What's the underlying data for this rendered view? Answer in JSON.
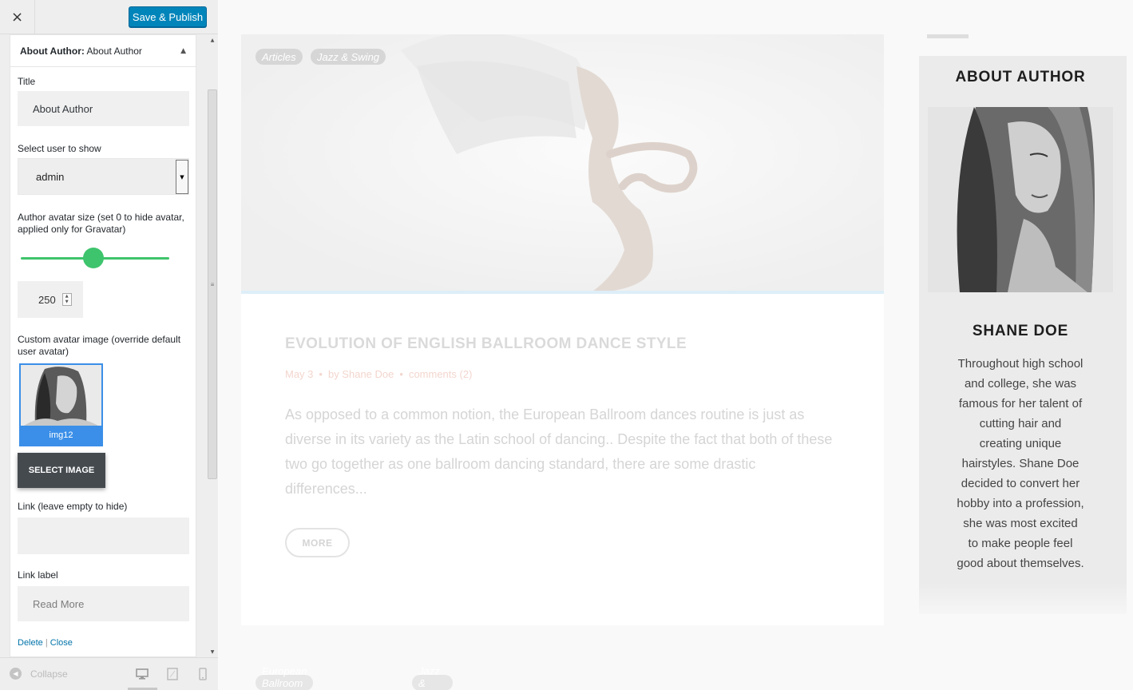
{
  "customizer": {
    "close_label": "×",
    "publish_label": "Save & Publish",
    "panel": {
      "title_prefix": "About Author:",
      "title_name": "About Author",
      "fields": {
        "title_label": "Title",
        "title_value": "About Author",
        "user_label": "Select user to show",
        "user_value": "admin",
        "avatar_size_label": "Author avatar size (set 0 to hide avatar, applied only for Gravatar)",
        "avatar_size_value": "250",
        "avatar_size_fraction": 0.49,
        "custom_avatar_label": "Custom avatar image (override default user avatar)",
        "image_caption": "img12",
        "select_image_label": "SELECT IMAGE",
        "link_label": "Link (leave empty to hide)",
        "link_value": "",
        "link_text_label": "Link label",
        "link_text_value": "Read More"
      },
      "actions": {
        "delete": "Delete",
        "separator": "|",
        "close": "Close"
      }
    },
    "footer": {
      "collapse_label": "Collapse",
      "devices": [
        "desktop-icon",
        "tablet-icon",
        "mobile-icon"
      ]
    }
  },
  "preview": {
    "post": {
      "tags": [
        "Articles",
        "Jazz & Swing"
      ],
      "title": "EVOLUTION OF ENGLISH BALLROOM DANCE STYLE",
      "date": "May 3",
      "bullet": "•",
      "author": "by Shane Doe",
      "comments": "comments (2)",
      "excerpt": "As opposed to a common notion, the European Ballroom dances routine is just as diverse in its variety as the Latin school of dancing.. Despite the fact that both of these two go together as one ballroom dancing standard, there are some drastic differences...",
      "more_label": "MORE"
    },
    "next_post_tags": [
      "European Ballroom Dances",
      "Jazz & Swing"
    ],
    "author_widget": {
      "title": "ABOUT AUTHOR",
      "name": "SHANE DOE",
      "bio": "Throughout high school and college, she was famous for her talent of cutting hair and creating unique hairstyles. Shane Doe decided to convert her hobby into a profession, she was most excited to make people feel good about themselves."
    }
  },
  "colors": {
    "publish": "#0085ba",
    "slider": "#3ec46d",
    "image_select": "#3b8fe8",
    "link": "#0073aa"
  }
}
